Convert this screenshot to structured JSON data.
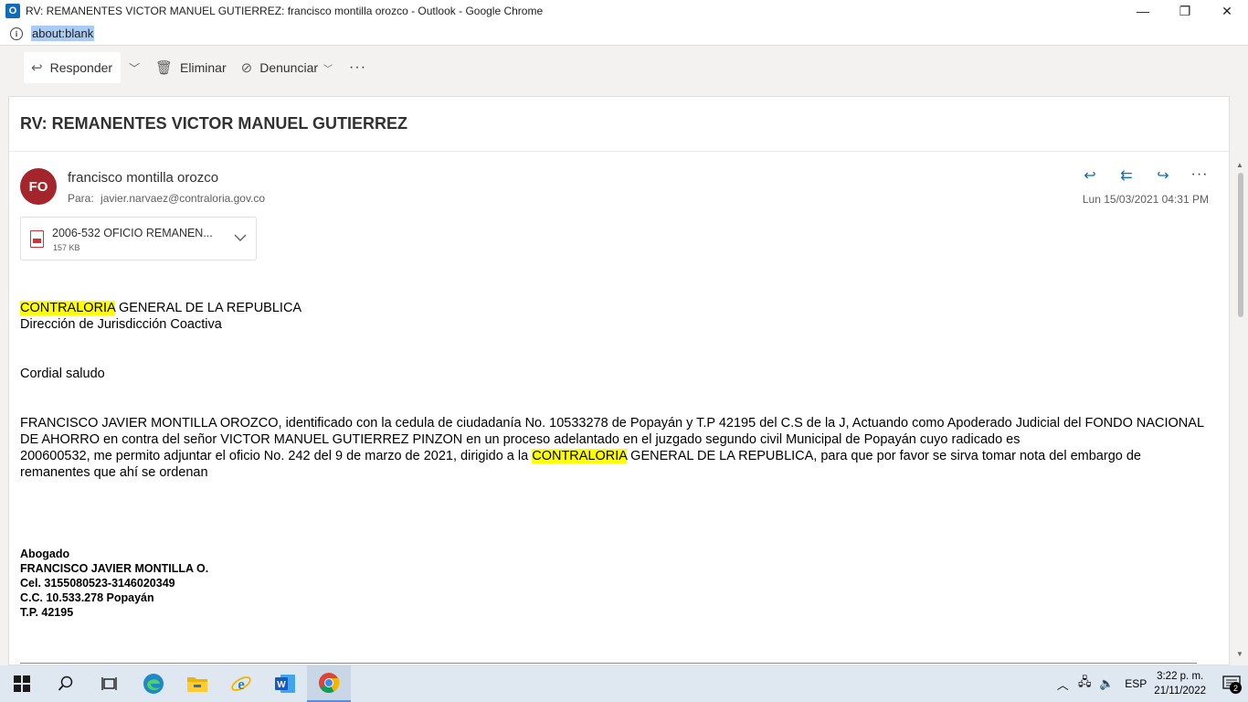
{
  "window": {
    "title": "RV: REMANENTES VICTOR MANUEL GUTIERREZ: francisco montilla orozco - Outlook - Google Chrome",
    "app_icon_letter": "O",
    "minimize": "—",
    "restore": "❐",
    "close": "✕"
  },
  "address_bar": {
    "url": "about:blank",
    "info_icon": "i"
  },
  "toolbar": {
    "reply_label": "Responder",
    "delete_label": "Eliminar",
    "report_label": "Denunciar",
    "more_label": "···"
  },
  "message": {
    "subject": "RV: REMANENTES VICTOR MANUEL GUTIERREZ",
    "avatar_initials": "FO",
    "avatar_color": "#a4262c",
    "sender": "francisco montilla orozco",
    "to_label": "Para:",
    "to_address": "javier.narvaez@contraloria.gov.co",
    "date": "Lun 15/03/2021 04:31 PM",
    "attachment": {
      "name": "2006-532 OFICIO REMANEN...",
      "size": "157 KB"
    },
    "body": {
      "l1_hl": "CONTRALORIA",
      "l1_rest": " GENERAL DE LA REPUBLICA",
      "l2": "Dirección de Jurisdicción Coactiva",
      "greeting": "Cordial saludo",
      "p1": "FRANCISCO JAVIER MONTILLA OROZCO, identificado con la cedula de ciudadanía No. 10533278 de Popayán y T.P 42195 del C.S de la J, Actuando como Apoderado Judicial del FONDO NACIONAL DE AHORRO en contra del señor VICTOR MANUEL GUTIERREZ PINZON en un proceso adelantado en el juzgado segundo civil Municipal de Popayán cuyo radicado es",
      "p2_a": "200600532, me permito adjuntar el oficio No. 242 del 9 de marzo de 2021, dirigido a la ",
      "p2_hl": "CONTRALORIA",
      "p2_b": "  GENERAL DE LA REPUBLICA, para que por favor se sirva tomar nota del embargo de remanentes que ahí se ordenan"
    },
    "signature": [
      "Abogado",
      "FRANCISCO JAVIER MONTILLA O.",
      "Cel. 3155080523-3146020349",
      "C.C. 10.533.278 Popayán",
      "T.P. 42195"
    ]
  },
  "taskbar": {
    "language": "ESP",
    "time": "3:22 p. m.",
    "date": "21/11/2022",
    "notification_count": "2",
    "icons": [
      "windows-start-icon",
      "search-icon",
      "task-view-icon",
      "edge-icon",
      "file-explorer-icon",
      "internet-explorer-icon",
      "word-icon",
      "chrome-icon"
    ]
  },
  "colors": {
    "accent": "#0f6cbd",
    "highlight": "#ffff00"
  }
}
